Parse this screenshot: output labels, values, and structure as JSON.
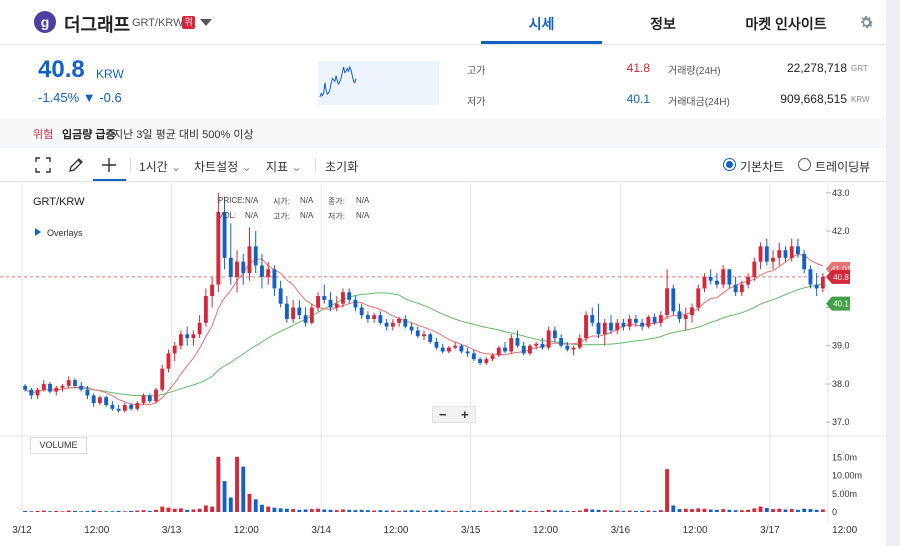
{
  "header": {
    "coin_logo": "g",
    "coin_name": "더그래프",
    "pair": "GRT/KRW",
    "warning_badge": "위",
    "tabs": [
      "시세",
      "정보",
      "마켓 인사이트"
    ],
    "active_tab": "시세"
  },
  "price": {
    "current": "40.8",
    "unit": "KRW",
    "change": "-1.45% ▼ -0.6"
  },
  "stats": {
    "high_label": "고가",
    "high_value": "41.8",
    "low_label": "저가",
    "low_value": "40.1",
    "volume_label": "거래량(24H)",
    "volume_value": "22,278,718",
    "volume_unit": "GRT",
    "amount_label": "거래대금(24H)",
    "amount_value": "909,668,515",
    "amount_unit": "KRW"
  },
  "notice": {
    "level": "위험",
    "title": "입금량 급증",
    "description": "지난 3일 평균 대비 500% 이상"
  },
  "toolbar": {
    "interval": "1시간",
    "chart_settings": "차트설정",
    "indicators": "지표",
    "reset": "초기화",
    "view_basic": "기본차트",
    "view_trading": "트레이딩뷰"
  },
  "chart_panel": {
    "pair": "GRT/KRW",
    "overlays": "Overlays",
    "ohlc_labels": [
      "PRICE:",
      "시가:",
      "종가:",
      "VOL:",
      "고가:",
      "저가:"
    ],
    "ohlc_value": "N/A",
    "volume_label": "VOL​UME",
    "zoom_out": "−",
    "zoom_in": "+"
  },
  "colors": {
    "up": "#d6263a",
    "down": "#1261c4",
    "ma_short": "#e57373",
    "ma_long": "#66bb6a",
    "accent": "#1261c4"
  },
  "chart_data": {
    "type": "candlestick",
    "y_ticks": [
      "43.0",
      "42.0",
      "41.0",
      "40.0",
      "39.0",
      "38.0",
      "37.0"
    ],
    "ylim": [
      36.9,
      43.1
    ],
    "volume_ticks": [
      "15.0m",
      "10.00m",
      "5.00m",
      "0"
    ],
    "volume_ylim": [
      0,
      16.8
    ],
    "x_ticks": [
      "3/12",
      "12:00",
      "3/13",
      "12:00",
      "3/14",
      "12:00",
      "3/15",
      "12:00",
      "3/16",
      "12:00",
      "3/17",
      "12:00"
    ],
    "x_tick_hours": [
      0,
      12,
      24,
      36,
      48,
      60,
      72,
      84,
      96,
      108,
      120,
      132
    ],
    "price_tags": {
      "high": "41.01",
      "current": "40.8",
      "low": "40.1"
    },
    "close_ref": 40.8,
    "candles": [
      [
        37.95,
        38.0,
        37.8,
        37.85,
        0.3
      ],
      [
        37.85,
        37.9,
        37.6,
        37.7,
        0.2
      ],
      [
        37.7,
        37.9,
        37.6,
        37.85,
        0.3
      ],
      [
        37.85,
        38.1,
        37.8,
        38.0,
        0.4
      ],
      [
        38.0,
        38.05,
        37.75,
        37.8,
        0.2
      ],
      [
        37.8,
        37.95,
        37.7,
        37.9,
        0.3
      ],
      [
        37.9,
        38.0,
        37.8,
        37.95,
        0.2
      ],
      [
        37.95,
        38.2,
        37.9,
        38.1,
        0.4
      ],
      [
        38.1,
        38.15,
        37.9,
        37.95,
        0.3
      ],
      [
        37.95,
        38.05,
        37.8,
        37.85,
        0.2
      ],
      [
        37.85,
        37.95,
        37.6,
        37.7,
        0.3
      ],
      [
        37.7,
        37.75,
        37.4,
        37.5,
        0.4
      ],
      [
        37.5,
        37.7,
        37.45,
        37.65,
        0.3
      ],
      [
        37.65,
        37.7,
        37.4,
        37.45,
        0.2
      ],
      [
        37.45,
        37.55,
        37.3,
        37.35,
        0.2
      ],
      [
        37.35,
        37.45,
        37.25,
        37.3,
        0.3
      ],
      [
        37.3,
        37.5,
        37.25,
        37.45,
        0.2
      ],
      [
        37.45,
        37.5,
        37.3,
        37.35,
        0.3
      ],
      [
        37.35,
        37.55,
        37.3,
        37.5,
        0.4
      ],
      [
        37.5,
        37.75,
        37.45,
        37.7,
        0.5
      ],
      [
        37.7,
        37.75,
        37.5,
        37.55,
        0.3
      ],
      [
        37.55,
        37.9,
        37.5,
        37.85,
        0.6
      ],
      [
        37.85,
        38.5,
        37.8,
        38.4,
        1.5
      ],
      [
        38.4,
        38.9,
        38.3,
        38.8,
        1.2
      ],
      [
        38.8,
        39.1,
        38.6,
        39.0,
        0.9
      ],
      [
        39.0,
        39.4,
        38.9,
        39.3,
        1.0
      ],
      [
        39.3,
        39.5,
        39.0,
        39.2,
        0.6
      ],
      [
        39.2,
        39.4,
        39.0,
        39.3,
        0.7
      ],
      [
        39.3,
        39.8,
        39.2,
        39.6,
        0.9
      ],
      [
        39.6,
        40.5,
        39.5,
        40.3,
        1.8
      ],
      [
        40.3,
        40.8,
        40.0,
        40.6,
        1.5
      ],
      [
        40.6,
        43.0,
        40.4,
        42.5,
        15.2
      ],
      [
        42.5,
        42.9,
        41.0,
        41.3,
        8.5
      ],
      [
        41.3,
        42.2,
        40.6,
        40.8,
        4.0
      ],
      [
        40.8,
        41.5,
        40.4,
        41.2,
        15.2
      ],
      [
        41.2,
        41.4,
        40.6,
        40.9,
        12.5
      ],
      [
        40.9,
        42.1,
        40.7,
        41.6,
        5.0
      ],
      [
        41.6,
        42.0,
        40.9,
        41.1,
        3.5
      ],
      [
        41.1,
        41.4,
        40.5,
        40.8,
        2.0
      ],
      [
        40.8,
        41.2,
        40.6,
        41.0,
        1.5
      ],
      [
        41.0,
        41.1,
        40.3,
        40.5,
        1.2
      ],
      [
        40.5,
        40.7,
        40.0,
        40.1,
        1.0
      ],
      [
        40.1,
        40.3,
        39.6,
        39.7,
        0.9
      ],
      [
        39.7,
        40.2,
        39.6,
        40.0,
        0.8
      ],
      [
        40.0,
        40.2,
        39.7,
        39.8,
        0.6
      ],
      [
        39.8,
        40.0,
        39.5,
        39.6,
        0.7
      ],
      [
        39.6,
        40.1,
        39.55,
        40.0,
        0.8
      ],
      [
        40.0,
        40.4,
        39.9,
        40.3,
        0.9
      ],
      [
        40.3,
        40.6,
        40.1,
        40.2,
        0.7
      ],
      [
        40.2,
        40.4,
        39.9,
        40.0,
        0.6
      ],
      [
        40.0,
        40.3,
        39.9,
        40.1,
        0.5
      ],
      [
        40.1,
        40.5,
        40.0,
        40.4,
        0.7
      ],
      [
        40.4,
        40.5,
        40.1,
        40.2,
        0.6
      ],
      [
        40.2,
        40.3,
        39.9,
        40.0,
        0.5
      ],
      [
        40.0,
        40.1,
        39.7,
        39.8,
        0.6
      ],
      [
        39.8,
        39.9,
        39.6,
        39.7,
        0.5
      ],
      [
        39.7,
        39.85,
        39.6,
        39.8,
        0.4
      ],
      [
        39.8,
        39.9,
        39.55,
        39.6,
        0.5
      ],
      [
        39.6,
        39.7,
        39.4,
        39.5,
        0.4
      ],
      [
        39.5,
        39.7,
        39.4,
        39.6,
        0.4
      ],
      [
        39.6,
        39.75,
        39.5,
        39.7,
        0.3
      ],
      [
        39.7,
        39.8,
        39.45,
        39.5,
        0.4
      ],
      [
        39.5,
        39.6,
        39.3,
        39.4,
        0.5
      ],
      [
        39.4,
        39.5,
        39.2,
        39.25,
        0.4
      ],
      [
        39.25,
        39.4,
        39.15,
        39.3,
        0.3
      ],
      [
        39.3,
        39.35,
        39.05,
        39.1,
        0.4
      ],
      [
        39.1,
        39.2,
        38.9,
        38.95,
        0.5
      ],
      [
        38.95,
        39.05,
        38.8,
        38.85,
        0.4
      ],
      [
        38.85,
        39.0,
        38.8,
        38.95,
        0.3
      ],
      [
        38.95,
        39.1,
        38.9,
        39.0,
        0.3
      ],
      [
        39.0,
        39.05,
        38.8,
        38.85,
        0.4
      ],
      [
        38.85,
        38.95,
        38.7,
        38.8,
        0.3
      ],
      [
        38.8,
        38.9,
        38.6,
        38.65,
        0.4
      ],
      [
        38.65,
        38.7,
        38.5,
        38.55,
        0.3
      ],
      [
        38.55,
        38.7,
        38.5,
        38.65,
        0.3
      ],
      [
        38.65,
        38.8,
        38.6,
        38.75,
        0.3
      ],
      [
        38.75,
        39.0,
        38.7,
        38.95,
        0.4
      ],
      [
        38.95,
        39.1,
        38.8,
        38.85,
        0.3
      ],
      [
        38.85,
        39.3,
        38.8,
        39.2,
        0.5
      ],
      [
        39.2,
        39.4,
        38.95,
        39.0,
        0.4
      ],
      [
        39.0,
        39.1,
        38.75,
        38.8,
        0.4
      ],
      [
        38.8,
        39.05,
        38.75,
        39.0,
        0.3
      ],
      [
        39.0,
        39.1,
        38.9,
        39.05,
        0.3
      ],
      [
        39.05,
        39.2,
        38.9,
        38.95,
        0.3
      ],
      [
        38.95,
        39.5,
        38.9,
        39.4,
        0.6
      ],
      [
        39.4,
        39.5,
        39.1,
        39.2,
        0.4
      ],
      [
        39.2,
        39.3,
        38.95,
        39.0,
        0.4
      ],
      [
        39.0,
        39.1,
        38.85,
        38.9,
        0.3
      ],
      [
        38.9,
        39.0,
        38.75,
        38.95,
        0.3
      ],
      [
        38.95,
        39.3,
        38.9,
        39.2,
        0.4
      ],
      [
        39.2,
        39.9,
        39.1,
        39.8,
        0.9
      ],
      [
        39.8,
        40.0,
        39.5,
        39.6,
        0.7
      ],
      [
        39.6,
        40.1,
        39.2,
        39.3,
        0.6
      ],
      [
        39.3,
        39.7,
        39.0,
        39.6,
        0.5
      ],
      [
        39.6,
        39.8,
        39.3,
        39.4,
        0.4
      ],
      [
        39.4,
        39.7,
        39.3,
        39.6,
        0.4
      ],
      [
        39.6,
        39.7,
        39.4,
        39.5,
        0.3
      ],
      [
        39.5,
        39.8,
        39.4,
        39.7,
        0.4
      ],
      [
        39.7,
        39.8,
        39.5,
        39.6,
        0.3
      ],
      [
        39.6,
        39.7,
        39.4,
        39.5,
        0.3
      ],
      [
        39.5,
        39.8,
        39.45,
        39.75,
        0.4
      ],
      [
        39.75,
        39.85,
        39.55,
        39.6,
        0.3
      ],
      [
        39.6,
        39.9,
        39.5,
        39.8,
        0.5
      ],
      [
        39.8,
        41.0,
        39.7,
        40.5,
        11.8
      ],
      [
        40.5,
        40.6,
        39.8,
        39.9,
        1.8
      ],
      [
        39.9,
        40.1,
        39.6,
        39.7,
        0.8
      ],
      [
        39.7,
        40.0,
        39.4,
        39.8,
        0.9
      ],
      [
        39.8,
        40.1,
        39.6,
        40.0,
        0.8
      ],
      [
        40.0,
        40.6,
        39.9,
        40.5,
        1.0
      ],
      [
        40.5,
        40.9,
        40.4,
        40.8,
        0.9
      ],
      [
        40.8,
        41.0,
        40.6,
        40.7,
        0.7
      ],
      [
        40.7,
        40.9,
        40.5,
        40.6,
        0.6
      ],
      [
        40.6,
        41.1,
        40.5,
        41.0,
        0.8
      ],
      [
        41.0,
        41.0,
        40.5,
        40.6,
        0.6
      ],
      [
        40.6,
        40.8,
        40.3,
        40.4,
        0.5
      ],
      [
        40.4,
        40.7,
        40.3,
        40.6,
        0.5
      ],
      [
        40.6,
        40.9,
        40.5,
        40.8,
        0.6
      ],
      [
        40.8,
        41.3,
        40.7,
        41.2,
        1.0
      ],
      [
        41.2,
        41.7,
        41.0,
        41.6,
        1.5
      ],
      [
        41.6,
        41.8,
        41.1,
        41.2,
        1.1
      ],
      [
        41.2,
        41.5,
        41.0,
        41.3,
        0.8
      ],
      [
        41.3,
        41.7,
        41.1,
        41.5,
        0.9
      ],
      [
        41.5,
        41.6,
        41.2,
        41.3,
        0.7
      ],
      [
        41.3,
        41.8,
        41.2,
        41.6,
        0.8
      ],
      [
        41.6,
        41.8,
        41.3,
        41.4,
        0.6
      ],
      [
        41.4,
        41.5,
        40.9,
        41.0,
        0.9
      ],
      [
        41.0,
        41.1,
        40.5,
        40.6,
        0.8
      ],
      [
        40.6,
        40.9,
        40.3,
        40.5,
        0.6
      ],
      [
        40.5,
        40.9,
        40.4,
        40.8,
        0.7
      ]
    ]
  }
}
